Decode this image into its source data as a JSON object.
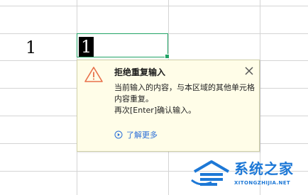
{
  "sheet": {
    "cell_a_value": "1",
    "active_cell_value": "1"
  },
  "tooltip": {
    "title": "拒绝重复输入",
    "body_line1": "当前输入的内容，与本区域的其他单元格内容重复。",
    "body_line2": "再次[Enter]确认输入。",
    "learn_more": "了解更多",
    "icon": "warning-triangle-icon",
    "accent_color": "#e8704a"
  },
  "watermark": {
    "title": "系统之家",
    "url": "XITONGZHIJIA.NET",
    "color": "#1d78d6"
  }
}
